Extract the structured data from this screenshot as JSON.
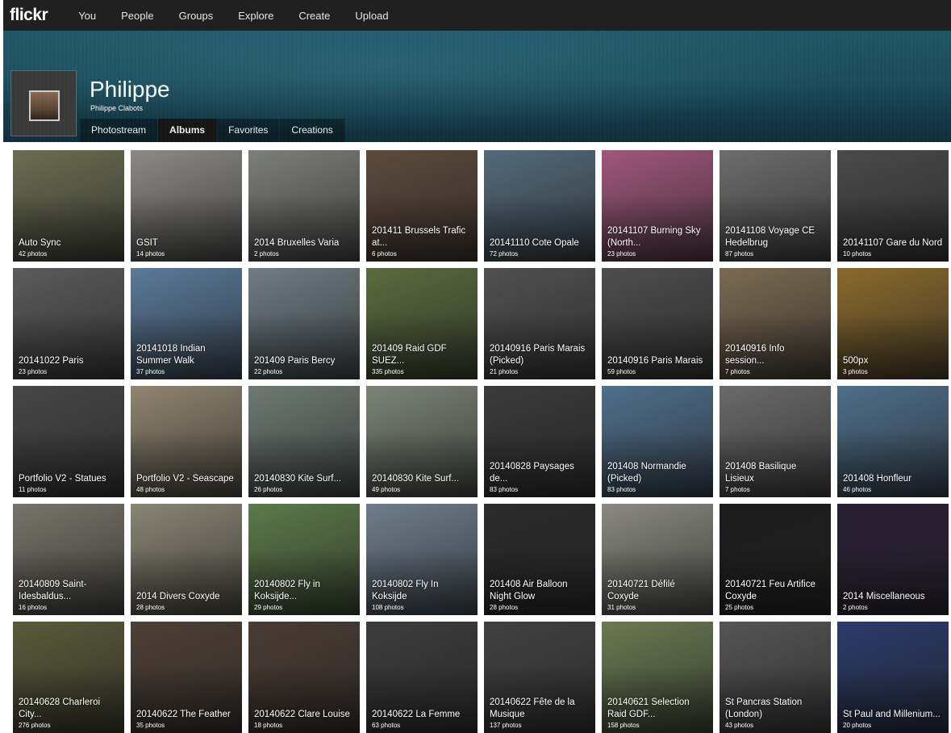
{
  "nav": {
    "logo": "flickr",
    "items": [
      "You",
      "People",
      "Groups",
      "Explore",
      "Create",
      "Upload"
    ]
  },
  "profile": {
    "name": "Philippe",
    "subname": "Philippe Clabots"
  },
  "tabs": [
    {
      "label": "Photostream",
      "active": false
    },
    {
      "label": "Albums",
      "active": true
    },
    {
      "label": "Favorites",
      "active": false
    },
    {
      "label": "Creations",
      "active": false
    }
  ],
  "albums": [
    {
      "title": "Auto Sync",
      "count": "42 photos",
      "bg": "#6b6d52"
    },
    {
      "title": "GSIT",
      "count": "14 photos",
      "bg": "#8c8a86"
    },
    {
      "title": "2014 Bruxelles Varia",
      "count": "2 photos",
      "bg": "#7d7f7a"
    },
    {
      "title": "201411 Brussels Trafic at...",
      "count": "6 photos",
      "bg": "#5c4a3c"
    },
    {
      "title": "20141110 Cote Opale",
      "count": "72 photos",
      "bg": "#546a7a"
    },
    {
      "title": "20141107 Burning Sky (North...",
      "count": "23 photos",
      "bg": "#a0577a"
    },
    {
      "title": "20141108 Voyage CE Hedelbrug",
      "count": "87 photos",
      "bg": "#6d6d6d"
    },
    {
      "title": "20141107 Gare du Nord",
      "count": "10 photos",
      "bg": "#4a4a4a"
    },
    {
      "title": "20141022 Paris",
      "count": "23 photos",
      "bg": "#5b5b5b"
    },
    {
      "title": "20141018 Indian Summer Walk",
      "count": "37 photos",
      "bg": "#5a7a9a"
    },
    {
      "title": "201409 Paris Bercy",
      "count": "22 photos",
      "bg": "#6f7d84"
    },
    {
      "title": "201409 Raid GDF SUEZ...",
      "count": "335 photos",
      "bg": "#5b6b3e"
    },
    {
      "title": "20140916 Paris Marais (Picked)",
      "count": "21 photos",
      "bg": "#505050"
    },
    {
      "title": "20140916 Paris Marais",
      "count": "59 photos",
      "bg": "#4d4d4d"
    },
    {
      "title": "20140916 Info session...",
      "count": "7 photos",
      "bg": "#7a6a52"
    },
    {
      "title": "500px",
      "count": "3 photos",
      "bg": "#8a6a2c"
    },
    {
      "title": "Portfolio V2 - Statues",
      "count": "11 photos",
      "bg": "#474747"
    },
    {
      "title": "Portfolio V2 - Seascape",
      "count": "48 photos",
      "bg": "#8f8570"
    },
    {
      "title": "20140830 Kite Surf...",
      "count": "26 photos",
      "bg": "#6f7a74"
    },
    {
      "title": "20140830 Kite Surf...",
      "count": "49 photos",
      "bg": "#7c8478"
    },
    {
      "title": "20140828 Paysages de...",
      "count": "83 photos",
      "bg": "#3a3a3a"
    },
    {
      "title": "201408 Normandie (Picked)",
      "count": "83 photos",
      "bg": "#4f6f8c"
    },
    {
      "title": "201408 Basilique Lisieux",
      "count": "7 photos",
      "bg": "#6a6a6a"
    },
    {
      "title": "201408 Honfleur",
      "count": "46 photos",
      "bg": "#4e6e8a"
    },
    {
      "title": "20140809 Saint-Idesbaldus...",
      "count": "16 photos",
      "bg": "#77746a"
    },
    {
      "title": "2014 Divers Coxyde",
      "count": "28 photos",
      "bg": "#8a8574"
    },
    {
      "title": "20140802 Fly in Koksijde...",
      "count": "29 photos",
      "bg": "#5c7a4a"
    },
    {
      "title": "20140802 Fly In Koksijde",
      "count": "108 photos",
      "bg": "#6f7e8c"
    },
    {
      "title": "201408 Air Balloon Night Glow",
      "count": "28 photos",
      "bg": "#2a2a2a"
    },
    {
      "title": "20140721 Défilé Coxyde",
      "count": "31 photos",
      "bg": "#8a8a82"
    },
    {
      "title": "20140721 Feu Artifice Coxyde",
      "count": "25 photos",
      "bg": "#1c1c1c"
    },
    {
      "title": "2014 Miscellaneous",
      "count": "2 photos",
      "bg": "#2a2035"
    },
    {
      "title": "20140628 Charleroi City...",
      "count": "276 photos",
      "bg": "#5a5a3a"
    },
    {
      "title": "20140622 The Feather",
      "count": "35 photos",
      "bg": "#4d4036"
    },
    {
      "title": "20140622 Clare Louise",
      "count": "18 photos",
      "bg": "#4a3c34"
    },
    {
      "title": "20140622 La Femme",
      "count": "63 photos",
      "bg": "#3c3c3c"
    },
    {
      "title": "20140622 Fête de la Musique",
      "count": "137 photos",
      "bg": "#414141"
    },
    {
      "title": "20140621 Selection Raid GDF...",
      "count": "158 photos",
      "bg": "#6a7a52"
    },
    {
      "title": "St Pancras Station (London)",
      "count": "43 photos",
      "bg": "#555555"
    },
    {
      "title": "St Paul and Millenium...",
      "count": "20 photos",
      "bg": "#2a3a6a"
    }
  ]
}
